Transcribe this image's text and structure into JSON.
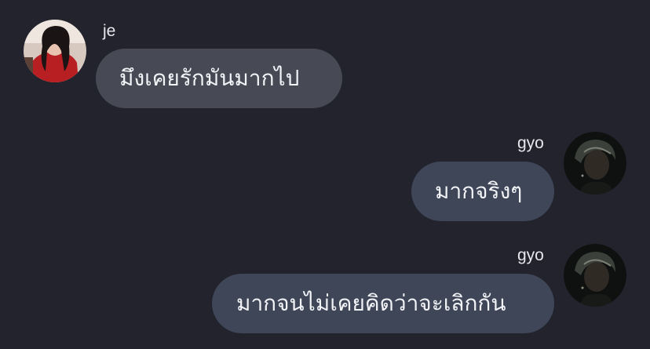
{
  "messages": [
    {
      "direction": "incoming",
      "sender": "je",
      "text": "มึงเคยรักมันมากไป"
    },
    {
      "direction": "outgoing",
      "sender": "gyo",
      "text": "มากจริงๆ"
    },
    {
      "direction": "outgoing",
      "sender": "gyo",
      "text": "มากจนไม่เคยคิดว่าจะเลิกกัน"
    }
  ],
  "colors": {
    "background": "#22232d",
    "incoming_bubble": "#474a55",
    "outgoing_bubble": "#3e4657",
    "text": "#f2f3f7"
  }
}
